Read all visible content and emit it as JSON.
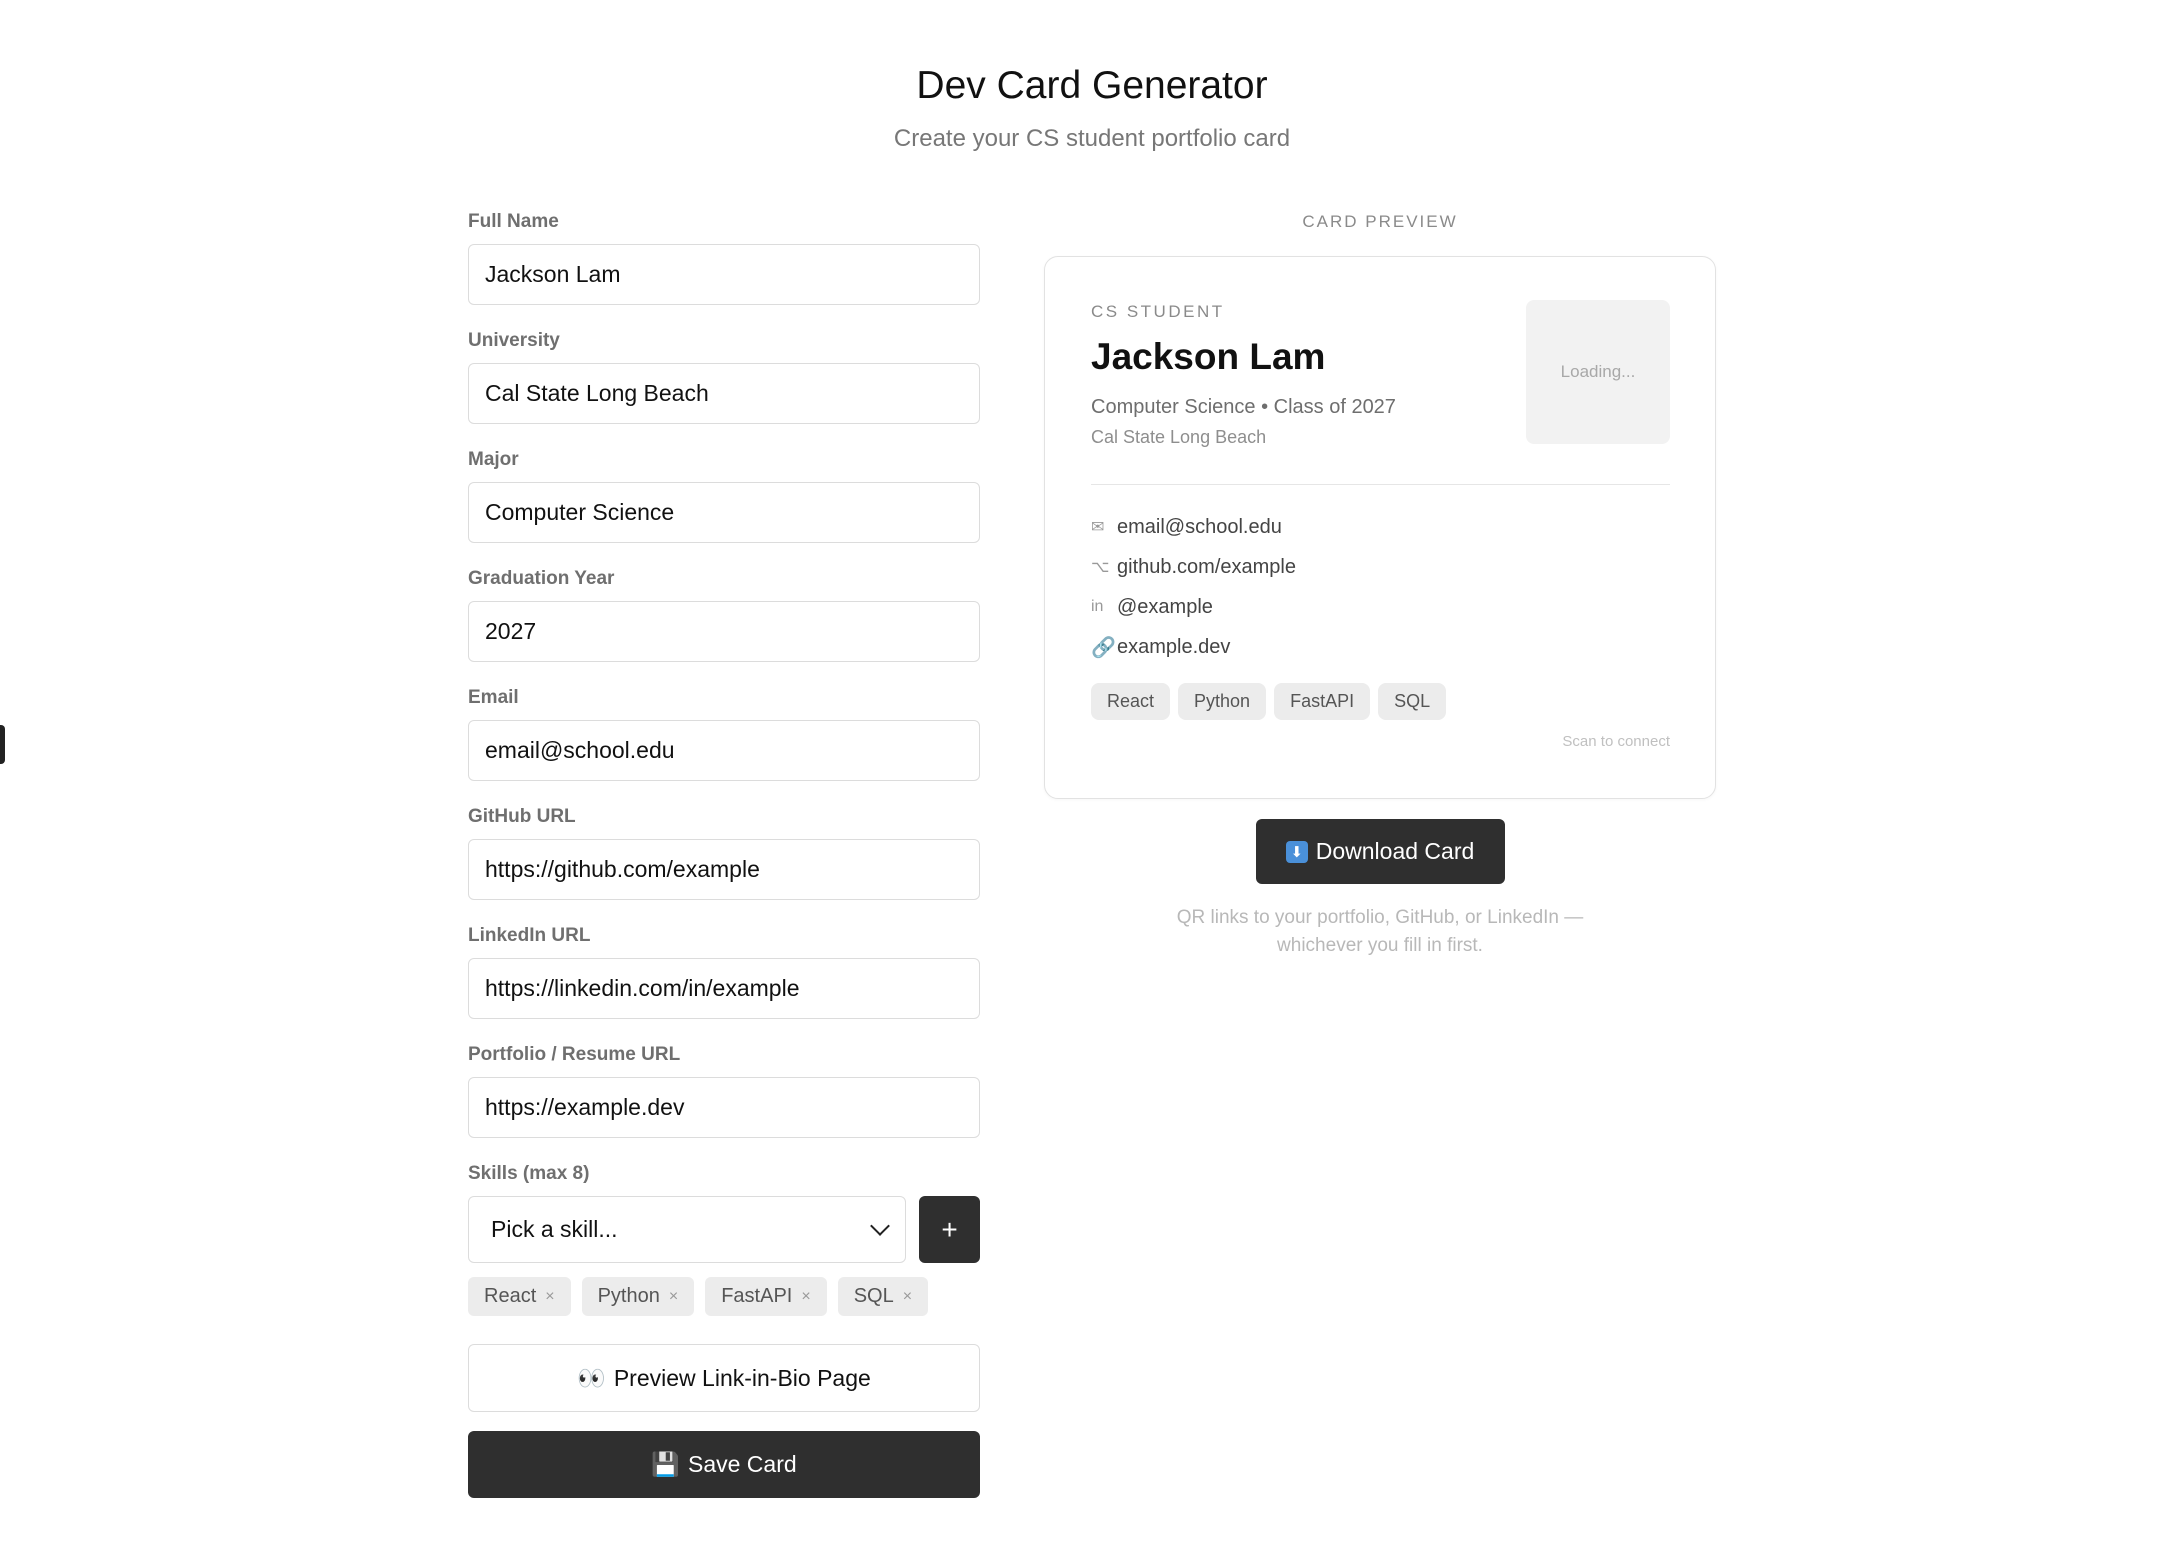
{
  "header": {
    "title": "Dev Card Generator",
    "subtitle": "Create your CS student portfolio card"
  },
  "form": {
    "fields": [
      {
        "label": "Full Name",
        "value": "Jackson Lam"
      },
      {
        "label": "University",
        "value": "Cal State Long Beach"
      },
      {
        "label": "Major",
        "value": "Computer Science"
      },
      {
        "label": "Graduation Year",
        "value": "2027"
      },
      {
        "label": "Email",
        "value": "email@school.edu"
      },
      {
        "label": "GitHub URL",
        "value": "https://github.com/example"
      },
      {
        "label": "LinkedIn URL",
        "value": "https://linkedin.com/in/example"
      },
      {
        "label": "Portfolio / Resume URL",
        "value": "https://example.dev"
      }
    ],
    "skills_label": "Skills (max 8)",
    "skill_select_value": "Pick a skill...",
    "add_skill_label": "+",
    "skills": [
      {
        "name": "React",
        "remove": "×"
      },
      {
        "name": "Python",
        "remove": "×"
      },
      {
        "name": "FastAPI",
        "remove": "×"
      },
      {
        "name": "SQL",
        "remove": "×"
      }
    ],
    "preview_link_emoji": "👀",
    "preview_link_label": "Preview Link-in-Bio Page",
    "save_emoji": "💾",
    "save_label": "Save Card"
  },
  "preview": {
    "section_label": "CARD PREVIEW",
    "role": "CS STUDENT",
    "name": "Jackson Lam",
    "major_line": "Computer Science • Class of 2027",
    "university": "Cal State Long Beach",
    "qr_status": "Loading...",
    "contacts": [
      {
        "icon": "✉",
        "icon_name": "mail-icon",
        "text": "email@school.edu"
      },
      {
        "icon": "⌥",
        "icon_name": "github-icon",
        "text": "github.com/example"
      },
      {
        "icon": "in",
        "icon_name": "linkedin-icon",
        "text": "@example"
      },
      {
        "icon": "🔗",
        "icon_name": "link-icon",
        "text": "example.dev"
      }
    ],
    "skills": [
      "React",
      "Python",
      "FastAPI",
      "SQL"
    ],
    "scan_text": "Scan to connect",
    "download_icon": "⬇",
    "download_label": "Download Card",
    "note_line1": "QR links to your portfolio, GitHub, or LinkedIn —",
    "note_line2": "whichever you fill in first."
  },
  "colors": {
    "dark_button": "#2f2f2f",
    "chip_bg": "#ececec",
    "border": "#dcdcdc",
    "muted_text": "#777777"
  }
}
